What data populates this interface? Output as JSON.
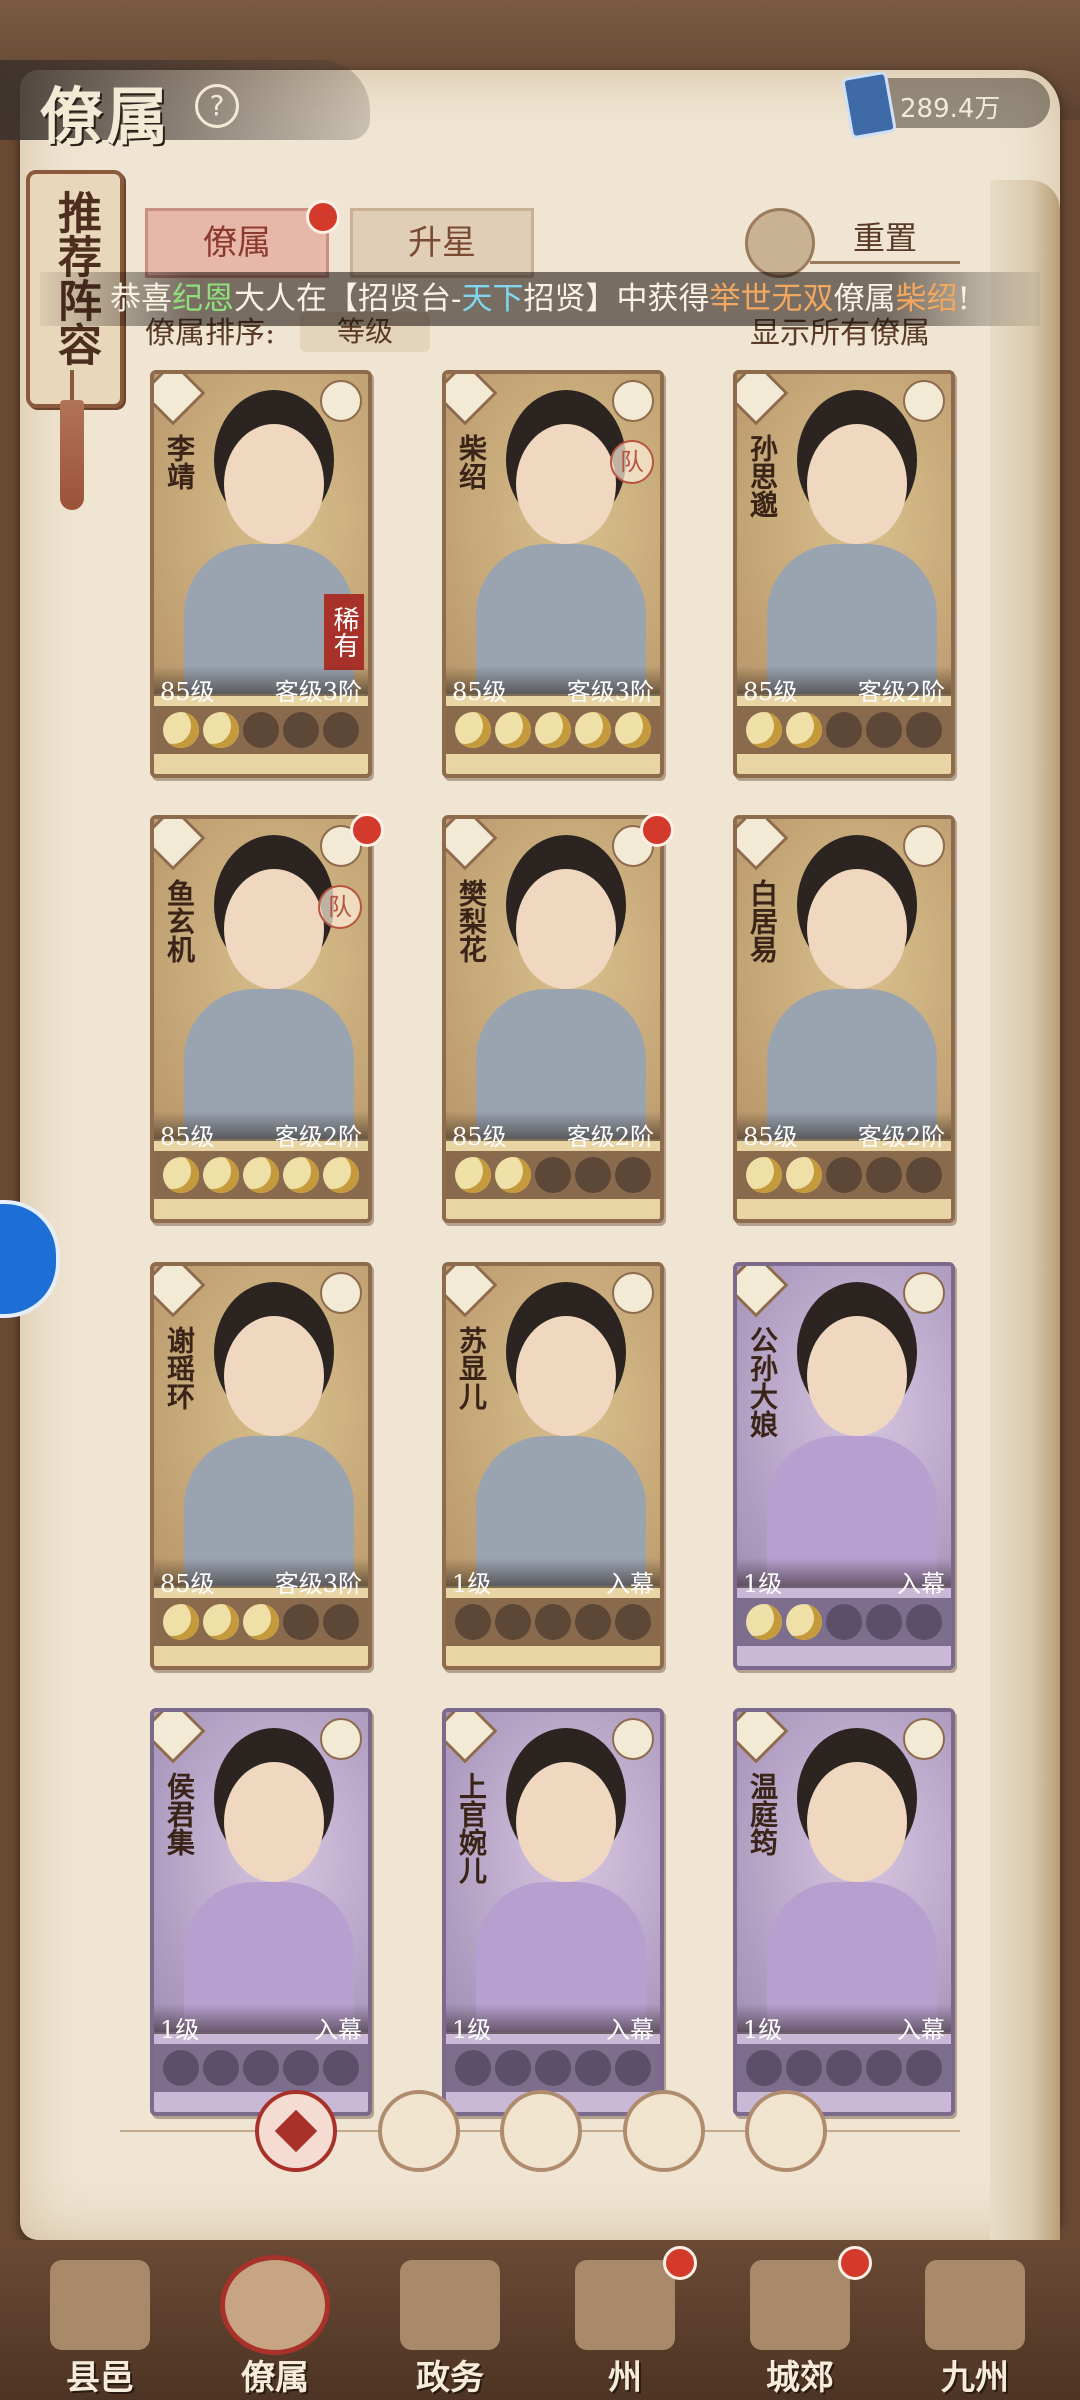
{
  "header": {
    "title": "僚属",
    "currency_value": "289.4万"
  },
  "side_tag": {
    "label": "推荐阵容"
  },
  "tabs": [
    {
      "label": "僚属"
    },
    {
      "label": "升星"
    }
  ],
  "reset_label": "重置",
  "announcement": {
    "p1": "恭喜",
    "user": "纪恩",
    "p2": "大人在【招贤台-",
    "pool": "天下",
    "p3": "招贤】中获得",
    "rarity": "举世无双",
    "p4": "僚属",
    "hero": "柴绍",
    "p5": "!"
  },
  "sort": {
    "label": "僚属排序:",
    "value": "等级",
    "show_all": "显示所有僚属"
  },
  "cards": [
    {
      "name": "李靖",
      "level": "85级",
      "rank": "客级3阶",
      "stars_on": 2,
      "badge": "稀有",
      "color": "gold"
    },
    {
      "name": "柴绍",
      "level": "85级",
      "rank": "客级3阶",
      "stars_on": 5,
      "badge": "队",
      "color": "gold"
    },
    {
      "name": "孙思邈",
      "level": "85级",
      "rank": "客级2阶",
      "stars_on": 2,
      "color": "gold"
    },
    {
      "name": "鱼玄机",
      "level": "85级",
      "rank": "客级2阶",
      "stars_on": 5,
      "badge": "队",
      "color": "gold"
    },
    {
      "name": "樊梨花",
      "level": "85级",
      "rank": "客级2阶",
      "stars_on": 2,
      "color": "gold"
    },
    {
      "name": "白居易",
      "level": "85级",
      "rank": "客级2阶",
      "stars_on": 2,
      "color": "gold"
    },
    {
      "name": "谢瑶环",
      "level": "85级",
      "rank": "客级3阶",
      "stars_on": 3,
      "color": "gold"
    },
    {
      "name": "苏显儿",
      "level": "1级",
      "rank": "入幕",
      "stars_on": 0,
      "color": "gold"
    },
    {
      "name": "公孙大娘",
      "level": "1级",
      "rank": "入幕",
      "stars_on": 2,
      "color": "purple"
    },
    {
      "name": "侯君集",
      "level": "1级",
      "rank": "入幕",
      "stars_on": 0,
      "color": "purple"
    },
    {
      "name": "上官婉儿",
      "level": "1级",
      "rank": "入幕",
      "stars_on": 0,
      "color": "purple"
    },
    {
      "name": "温庭筠",
      "level": "1级",
      "rank": "入幕",
      "stars_on": 0,
      "color": "purple"
    }
  ],
  "nav": [
    {
      "label": "县邑"
    },
    {
      "label": "僚属"
    },
    {
      "label": "政务"
    },
    {
      "label": "州"
    },
    {
      "label": "城郊"
    },
    {
      "label": "九州"
    }
  ]
}
